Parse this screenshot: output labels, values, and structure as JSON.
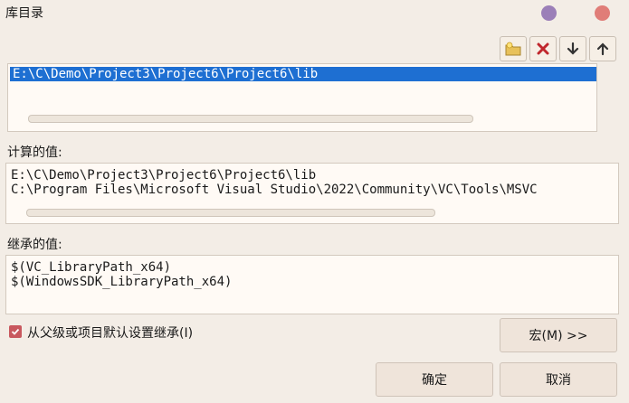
{
  "window": {
    "title": "库目录"
  },
  "toolbar": {
    "buttons": [
      {
        "icon": "new-folder-icon"
      },
      {
        "icon": "delete-icon"
      },
      {
        "icon": "arrow-down-icon"
      },
      {
        "icon": "arrow-up-icon"
      }
    ]
  },
  "editor": {
    "lines": [
      "E:\\C\\Demo\\Project3\\Project6\\Project6\\lib"
    ]
  },
  "computed": {
    "label": "计算的值:",
    "lines": [
      "E:\\C\\Demo\\Project3\\Project6\\Project6\\lib",
      "C:\\Program Files\\Microsoft Visual Studio\\2022\\Community\\VC\\Tools\\MSVC"
    ]
  },
  "inherited": {
    "label": "继承的值:",
    "lines": [
      "$(VC_LibraryPath_x64)",
      "$(WindowsSDK_LibraryPath_x64)"
    ]
  },
  "inherit_checkbox": {
    "label": "从父级或项目默认设置继承(I)",
    "checked": true
  },
  "buttons": {
    "macros": "宏(M) >>",
    "ok": "确定",
    "cancel": "取消"
  },
  "colors": {
    "selection": "#1e6fd2",
    "checkbox": "#c8585e",
    "background": "#f3ede6"
  }
}
